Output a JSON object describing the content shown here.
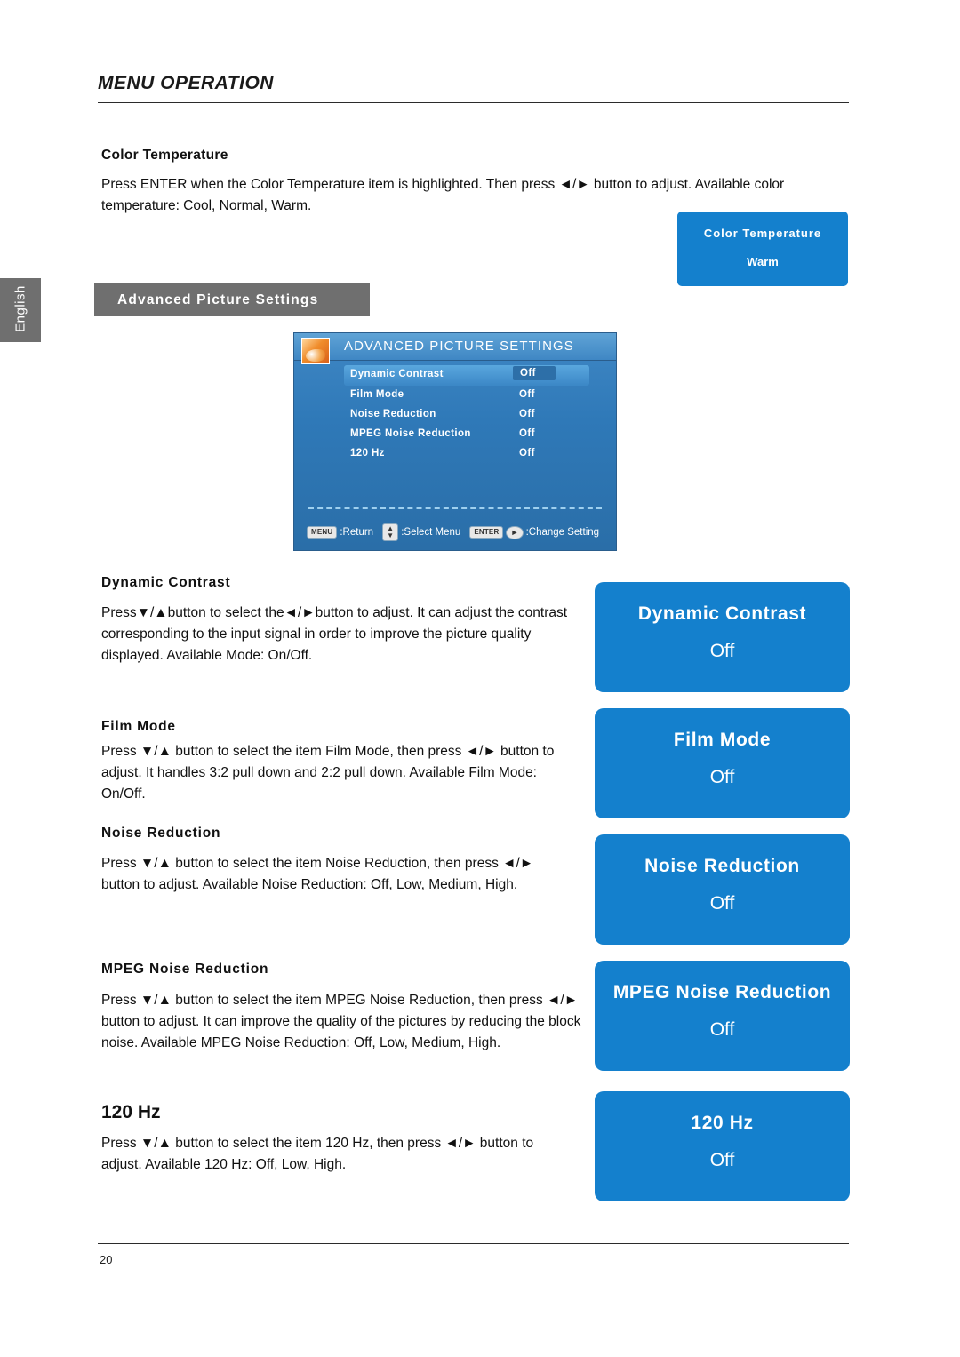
{
  "header": {
    "title": "MENU OPERATION"
  },
  "side_tab": {
    "label": "English"
  },
  "sections": {
    "color_temperature": {
      "title": "Color Temperature",
      "body": "Press ENTER when the Color Temperature item is highlighted. Then press ◄/► button to adjust. Available color temperature: Cool, Normal, Warm."
    },
    "advanced_band": {
      "label": "Advanced Picture Settings"
    },
    "dynamic_contrast": {
      "title": "Dynamic Contrast",
      "body": "Press▼/▲button to select the◄/►button to adjust. It can adjust the contrast corresponding to the input signal in order to improve the picture quality displayed. Available Mode: On/Off."
    },
    "film_mode": {
      "title": "Film Mode",
      "body": "Press ▼/▲ button to select the item Film Mode, then press ◄/► button to adjust. It handles 3:2 pull down and 2:2 pull down. Available Film Mode: On/Off."
    },
    "noise_reduction": {
      "title": "Noise Reduction",
      "body": "Press ▼/▲ button to select the item Noise Reduction, then press ◄/► button to adjust. Available Noise Reduction: Off, Low, Medium, High."
    },
    "mpeg_noise_reduction": {
      "title": "MPEG Noise Reduction",
      "body": "Press ▼/▲ button to select the item MPEG Noise Reduction, then press ◄/► button to adjust. It can improve the quality of the pictures by reducing the block noise. Available MPEG Noise Reduction: Off, Low, Medium, High."
    },
    "hz120": {
      "title": "120 Hz",
      "body": "Press ▼/▲ button to select the item 120 Hz, then press ◄/► button to adjust. Available 120 Hz: Off, Low, High."
    }
  },
  "osd": {
    "title": "ADVANCED PICTURE SETTINGS",
    "rows": [
      {
        "label": "Dynamic Contrast",
        "value": "Off",
        "selected": true
      },
      {
        "label": "Film Mode",
        "value": "Off",
        "selected": false
      },
      {
        "label": "Noise Reduction",
        "value": "Off",
        "selected": false
      },
      {
        "label": "MPEG Noise Reduction",
        "value": "Off",
        "selected": false
      },
      {
        "label": "120 Hz",
        "value": "Off",
        "selected": false
      }
    ],
    "footer": {
      "menu_key": "MENU",
      "menu_text": ":Return",
      "select_key_top": "▲",
      "select_key_bottom": "▼",
      "select_text": ":Select Menu",
      "enter_key": "ENTER",
      "arrow_key": "►",
      "change_text": ":Change Setting"
    }
  },
  "callouts": {
    "color_temperature": {
      "title": "Color Temperature",
      "value": "Warm"
    },
    "dynamic_contrast": {
      "title": "Dynamic Contrast",
      "value": "Off"
    },
    "film_mode": {
      "title": "Film Mode",
      "value": "Off"
    },
    "noise_reduction": {
      "title": "Noise Reduction",
      "value": "Off"
    },
    "mpeg_noise_reduction": {
      "title": "MPEG Noise Reduction",
      "value": "Off"
    },
    "hz120": {
      "title": "120 Hz",
      "value": "Off"
    }
  },
  "footer": {
    "page_number": "20"
  },
  "colors": {
    "accent_blue": "#1480cd",
    "osd_blue": "#2f79b8",
    "band_grey": "#6f6f6f"
  }
}
